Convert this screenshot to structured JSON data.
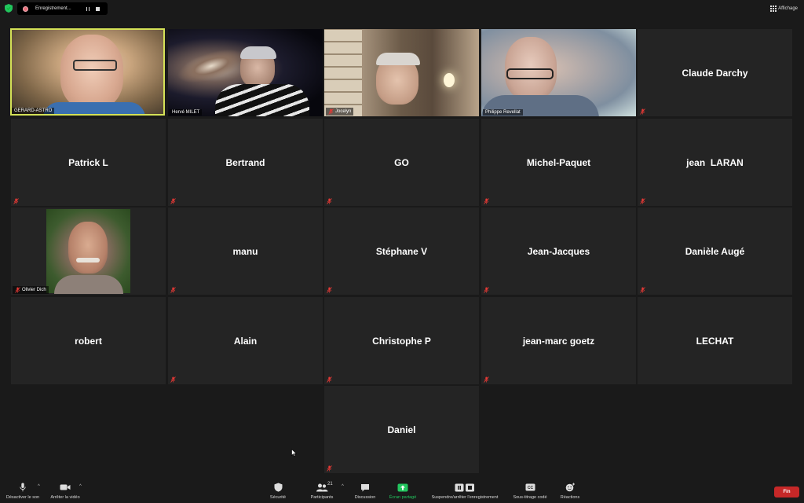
{
  "recording": {
    "label": "Enregistrement..."
  },
  "view": {
    "label": "Affichage"
  },
  "colors": {
    "active_speaker": "#d4e157",
    "share_green": "#22c55e",
    "end_red": "#c62828",
    "mute_red": "#e53935"
  },
  "participants": [
    {
      "name": "GERARD-ASTRO"
    },
    {
      "name": "Hervé MILET"
    },
    {
      "name": "Jocelyn"
    },
    {
      "name": "Philippe Revellat"
    },
    {
      "name": "Claude Darchy"
    },
    {
      "name": "Patrick L"
    },
    {
      "name": "Bertrand"
    },
    {
      "name": "GO"
    },
    {
      "name": "Michel-Paquet"
    },
    {
      "name": "jean  LARAN"
    },
    {
      "name": "Olivier Dich"
    },
    {
      "name": "manu"
    },
    {
      "name": "Stéphane V"
    },
    {
      "name": "Jean-Jacques"
    },
    {
      "name": "Danièle Augé"
    },
    {
      "name": "robert"
    },
    {
      "name": "Alain"
    },
    {
      "name": "Christophe P"
    },
    {
      "name": "jean-marc goetz"
    },
    {
      "name": "LECHAT"
    },
    {
      "name": "Daniel"
    }
  ],
  "toolbar": {
    "mute": "Désactiver le son",
    "video": "Arrêter la vidéo",
    "security": "Sécurité",
    "participants": "Participants",
    "participant_count": "21",
    "chat": "Discussion",
    "share": "Écran partagé",
    "record": "Suspendre/arrêter l'enregistrement",
    "captions": "Sous-titrage codé",
    "reactions": "Réactions",
    "end": "Fin"
  }
}
